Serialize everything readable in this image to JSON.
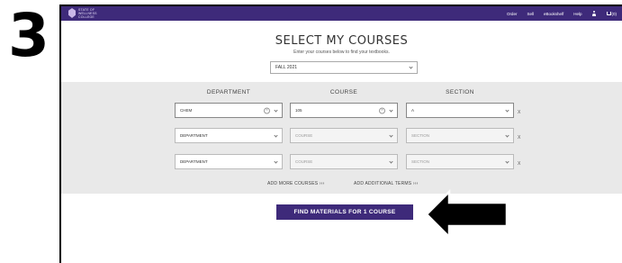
{
  "step": "3",
  "header": {
    "logo_text": "STATE OF\nWELLNESS\nCOLLEGE",
    "nav": [
      "Order",
      "Sell",
      "eBookshelf",
      "Help"
    ],
    "cart_count": "(0)"
  },
  "page": {
    "title": "SELECT MY COURSES",
    "subtitle": "Enter your courses below to find your textbooks."
  },
  "term": {
    "value": "FALL 2021"
  },
  "columns": [
    "DEPARTMENT",
    "COURSE",
    "SECTION"
  ],
  "rows": [
    {
      "department": "CHEM",
      "course": "105",
      "section": "A"
    },
    {
      "department": "DEPARTMENT",
      "course": "COURSE",
      "section": "SECTION"
    },
    {
      "department": "DEPARTMENT",
      "course": "COURSE",
      "section": "SECTION"
    }
  ],
  "remove_label": "X",
  "links": {
    "add_courses": "ADD MORE COURSES ›››",
    "add_terms": "ADD ADDITIONAL TERMS ›››"
  },
  "find_button": "FIND MATERIALS FOR 1 COURSE",
  "colors": {
    "brand": "#3e2a7a",
    "panel": "#e9e9e9"
  }
}
